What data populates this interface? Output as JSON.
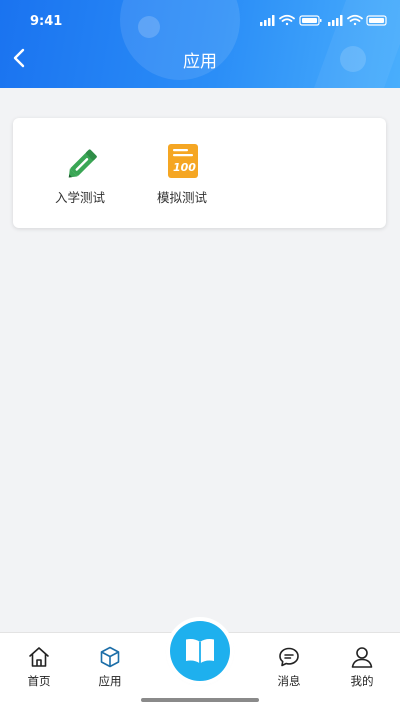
{
  "status_bar": {
    "time": "9:41"
  },
  "header": {
    "title": "应用",
    "back_icon": "chevron-left-icon"
  },
  "apps": [
    {
      "label": "入学测试",
      "icon": "pencil-icon",
      "color": "#3aa655"
    },
    {
      "label": "模拟测试",
      "icon": "exam-paper-icon",
      "color": "#f5a623"
    }
  ],
  "bottom_nav": {
    "items": [
      {
        "label": "首页",
        "icon": "home-icon"
      },
      {
        "label": "应用",
        "icon": "cube-icon"
      },
      {
        "label": "消息",
        "icon": "message-icon"
      },
      {
        "label": "我的",
        "icon": "user-icon"
      }
    ],
    "center_icon": "book-icon",
    "center_color": "#1eb0ee"
  },
  "colors": {
    "header_start": "#1a73f0",
    "header_end": "#49aefc",
    "background": "#f2f3f5"
  }
}
